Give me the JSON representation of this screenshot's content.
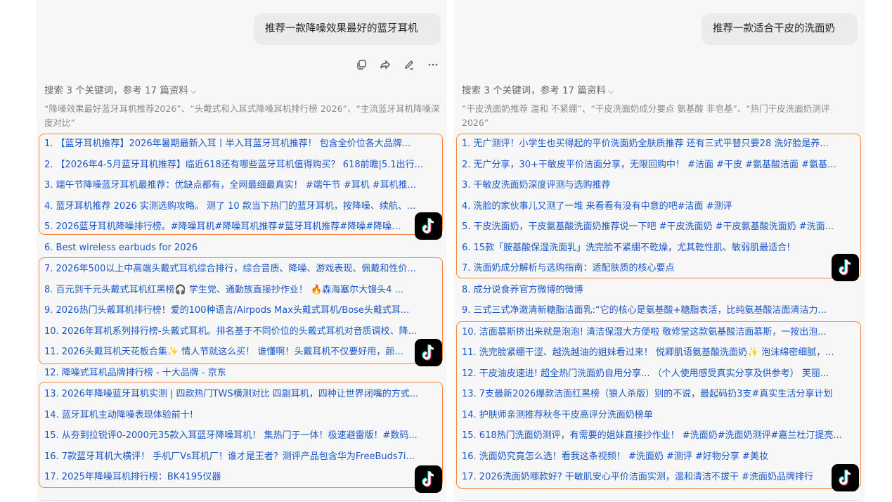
{
  "left": {
    "query": "推荐一款降噪效果最好的蓝牙耳机",
    "search_meta": "搜索 3 个关键词，参考 17 篇资料",
    "keywords_text": "“降噪效果最好蓝牙耳机推荐2026”、“头戴式和入耳式降噪耳机排行榜 2026”、“主流蓝牙耳机降噪深度对比”",
    "items": [
      "1.   【蓝牙耳机推荐】2026年暑期最新入耳丨半入耳蓝牙耳机推荐！ 包含全价位各大品牌...",
      "2.   【2026年4-5月蓝牙耳机推荐】临近618还有哪些蓝牙耳机值得购买？ 618前瞻|5.1出行...",
      "3.   端午节降噪蓝牙耳机最推荐：优缺点都有，全网最细最真实！ #端午节 #耳机 #耳机推...",
      "4.   蓝牙耳机推荐 2026 实测选购攻略。 测了 10 款当下热门的蓝牙耳机，按降噪、续航、...",
      "5.   2026蓝牙耳机降噪排行榜。#降噪耳机#降噪耳机推荐#蓝牙耳机推荐#降噪#降噪深...",
      "6.   Best wireless earbuds for 2026",
      "7.   2026年500以上中高端头戴式耳机综合排行，综合音质、降噪、游戏表现、佩戴和性价...",
      "8.   百元到千元头戴式耳机红黑榜🎧 学生党、通勤族直接抄作业！ 🔥森海塞尔大馒头4 ...",
      "9.   2026热门头戴耳机排行榜！爱的100种语言/Airpods Max头戴式耳机/Bose头戴式耳...",
      "10. 2026年耳机系列排行榜-头戴式耳机。排名基于不同价位的头戴式耳机对音质调校、降...",
      "11. 2026头戴耳机天花板合集✨ 情人节就这么买！ 谁懂啊！头戴耳机不仅要好用，颜...",
      "12. 降噪式耳机品牌排行榜 - 十大品牌 - 京东",
      "13. 2026年降噪蓝牙耳机实测 | 四款热门TWS横测对比 四副耳机，四种让世界闭嘴的方式...",
      "14. 蓝牙耳机主动降噪表现体验前十!",
      "15. 从夯到拉锐评0-2000元35款入耳蓝牙降噪耳机！ 集热门于一体！极速避雷版！#数码...",
      "16. 7款蓝牙耳机大横评！ 手机厂Vs耳机厂！谁才是王者？测评产品包含华为FreeBuds7i...",
      "17. 2025年降噪耳机排行榜：BK4195仪器"
    ]
  },
  "right": {
    "query": "推荐一款适合干皮的洗面奶",
    "search_meta": "搜索 3 个关键词，参考 17 篇资料",
    "keywords_text": "“干皮洗面奶推荐 温和 不紧绷”、“干皮洗面奶成分要点 氨基酸 非皂基”、“热门干皮洗面奶测评 2026”",
    "items": [
      "1.   无广测评！小学生也买得起的平价洗面奶全肤质推荐 还有三式平替只要28 洗好脸是养...",
      "2.   无广分享，30+干敏皮平价洁面分享，无限回购中！ #洁面 #干皮 #氨基酸洁面 #氨基...",
      "3.   干敏皮洗面奶深度评测与选购推荐",
      "4.   洗脸的家伙事儿又测了一堆 来看看有没有中意的吧#洁面 #测评",
      "5.   干皮洗面奶，干皮氨基酸洗面奶推荐说一下吧 #干皮洗面奶 #干皮氨基酸洗面奶 #洗面...",
      "6.   15款「胺基酸保湿洗面乳」洗完脸不紧绷不乾燥，尤其乾性肌、敏弱肌最适合!",
      "7.   洗面奶成分解析与选购指南：适配肤质的核心要点",
      "8.   成分说食养官方微博的微博",
      "9.   三式三式净澈清新糖脂洁面乳:“它的核心是氨基酸+糖脂表活，比纯氨基酸洁面清洁力...",
      "10. 洁面慕斯挤出来就是泡泡! 清洁保湿大方便啦 敬修堂这款氨基酸洁面慕斯，一按出泡...",
      "11. 洗完脸紧绷干涩、越洗越油的姐妹看过来！ 悦卿肌语氨基酸洗面奶✨ 泡沫绵密细腻，...",
      "12. 干皮油皮速进! 超全热门洗面奶自用分享... （个人使用感受真实分享及供参考） 芙丽...",
      "13. 7支最新2026爆款洁面红黑榜（狼人杀版）别的不说，最起码扔3支#真实生活分享计划",
      "14. 护肤师亲测推荐秋冬干皮高评分洗面奶榜单",
      "15. 618热门洗面奶测评，有需要的姐妹直接抄作业！ #洗面奶#洗面奶测评#嘉兰杜汀提亮...",
      "16. 洗面奶究竟怎么选！看我这条视频！ #洗面奶 #测评 #好物分享 #美妆",
      "17. 2026洗面奶哪款好? 干敏肌安心平价洁面实测，温和清洁不拔干 #洗面奶品牌排行"
    ]
  },
  "colors": {
    "link": "#1a56c6",
    "highlight_border": "#f08a3c"
  },
  "icons": [
    "copy-icon",
    "share-icon",
    "edit-icon",
    "more-icon",
    "tiktok-icon",
    "chevron-down-icon"
  ]
}
